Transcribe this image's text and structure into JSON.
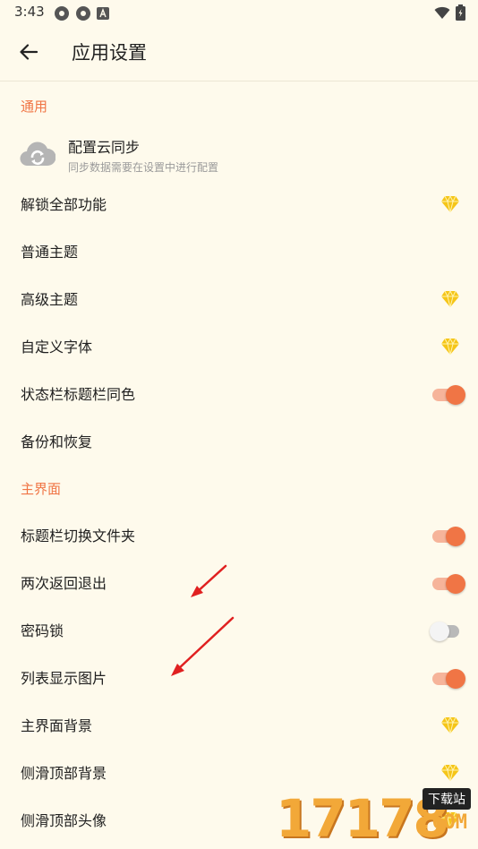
{
  "status_bar": {
    "time": "3:43"
  },
  "app_bar": {
    "title": "应用设置"
  },
  "sections": [
    {
      "header": "通用"
    },
    {
      "header": "主界面"
    }
  ],
  "cloud_sync": {
    "title": "配置云同步",
    "subtitle": "同步数据需要在设置中进行配置"
  },
  "general_items": [
    {
      "label": "解锁全部功能",
      "accessory": "gem"
    },
    {
      "label": "普通主题",
      "accessory": "none"
    },
    {
      "label": "高级主题",
      "accessory": "gem"
    },
    {
      "label": "自定义字体",
      "accessory": "gem"
    },
    {
      "label": "状态栏标题栏同色",
      "accessory": "toggle",
      "enabled": true
    },
    {
      "label": "备份和恢复",
      "accessory": "none"
    }
  ],
  "main_items": [
    {
      "label": "标题栏切换文件夹",
      "accessory": "toggle",
      "enabled": true
    },
    {
      "label": "两次返回退出",
      "accessory": "toggle",
      "enabled": true
    },
    {
      "label": "密码锁",
      "accessory": "toggle",
      "enabled": false
    },
    {
      "label": "列表显示图片",
      "accessory": "toggle",
      "enabled": true
    },
    {
      "label": "主界面背景",
      "accessory": "gem"
    },
    {
      "label": "侧滑顶部背景",
      "accessory": "gem"
    },
    {
      "label": "侧滑顶部头像",
      "accessory": "gem"
    }
  ],
  "watermark": {
    "digits": "17178",
    "badge": "下载站",
    "domain": ".COM"
  },
  "colors": {
    "accent": "#f07545",
    "background": "#fefaec",
    "gem": "#f5c518"
  }
}
